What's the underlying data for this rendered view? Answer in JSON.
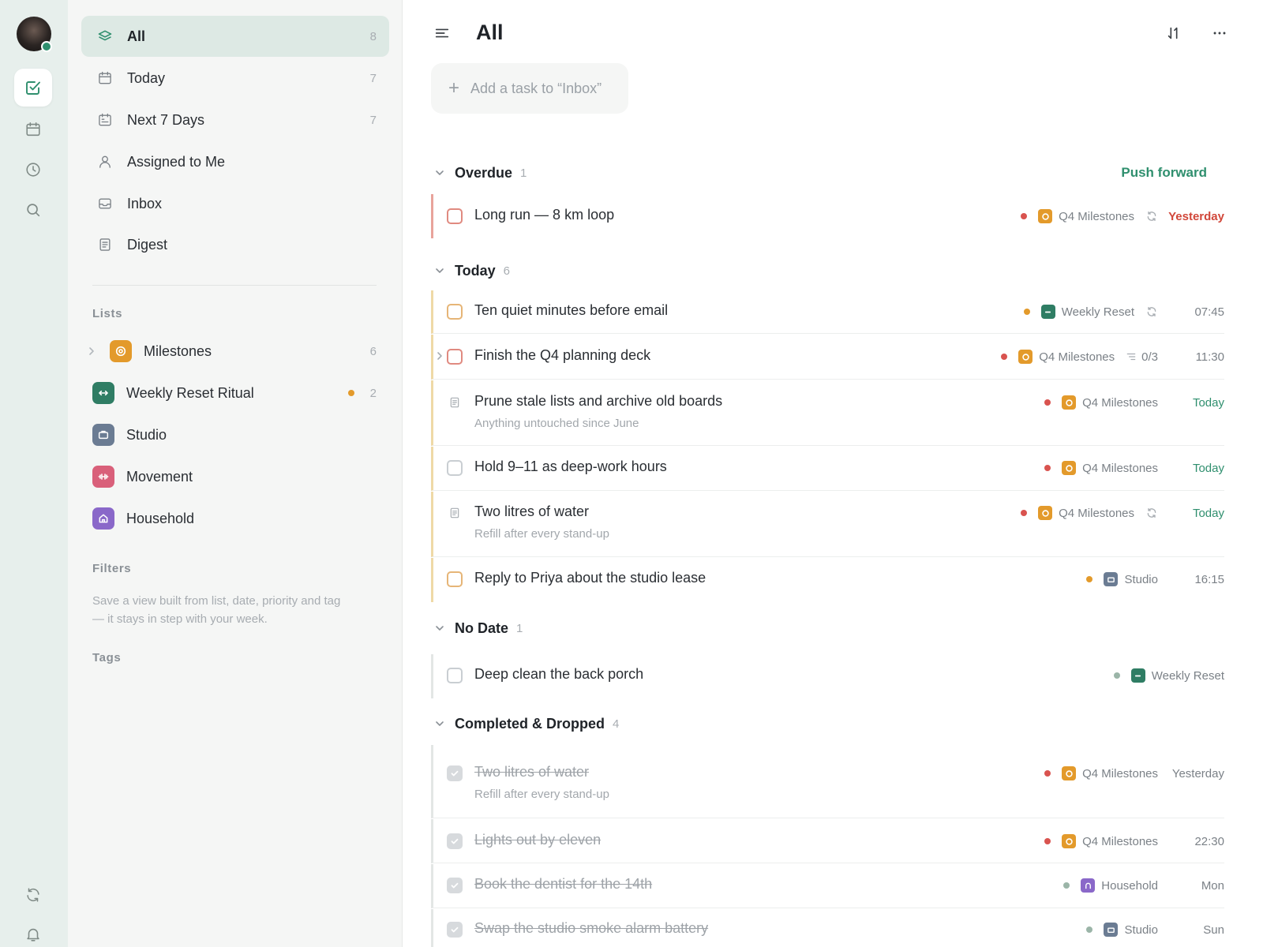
{
  "colors": {
    "accent": "#2f8f6e",
    "overdue": "#d1473a",
    "priority_high": "#d9534f",
    "priority_medium": "#e39a2b",
    "priority_low": "#9bb5a8",
    "list_milestones": "#e39a2b",
    "list_weekly_reset": "#2f7d64",
    "list_studio": "#6b7c93",
    "list_movement": "#d9607a",
    "list_household": "#8a68c9"
  },
  "rail": {
    "items": [
      {
        "icon": "checkbox-icon",
        "active": true
      },
      {
        "icon": "calendar-icon",
        "active": false
      },
      {
        "icon": "clock-icon",
        "active": false
      },
      {
        "icon": "search-icon",
        "active": false
      }
    ],
    "bottom": [
      {
        "icon": "sync-icon"
      },
      {
        "icon": "bell-icon"
      }
    ]
  },
  "sidebar": {
    "nav": [
      {
        "label": "All",
        "count": "8",
        "icon": "layers-icon"
      },
      {
        "label": "Today",
        "count": "7",
        "icon": "calendar-icon"
      },
      {
        "label": "Next 7 Days",
        "count": "7",
        "icon": "calendar-week-icon"
      },
      {
        "label": "Assigned to Me",
        "count": "",
        "icon": "person-icon"
      },
      {
        "label": "Inbox",
        "count": "",
        "icon": "inbox-icon"
      },
      {
        "label": "Digest",
        "count": "",
        "icon": "document-icon"
      }
    ],
    "lists_heading": "Lists",
    "lists": [
      {
        "label": "Milestones",
        "count": "6",
        "icon": "target-icon"
      },
      {
        "label": "Weekly Reset Ritual",
        "count": "2",
        "icon": "arrows-icon"
      },
      {
        "label": "Studio",
        "count": "",
        "icon": "briefcase-icon"
      },
      {
        "label": "Movement",
        "count": "",
        "icon": "dumbbell-icon"
      },
      {
        "label": "Household",
        "count": "",
        "icon": "house-icon"
      }
    ],
    "filters_heading": "Filters",
    "filters_hint": "Save a view built from list, date, priority and tag — it stays in step with your week.",
    "tags_heading": "Tags"
  },
  "header": {
    "title": "All",
    "add_task_placeholder": "Add a task to “Inbox”"
  },
  "groups": {
    "overdue": {
      "title": "Overdue",
      "count": "1",
      "action": "Push forward"
    },
    "today": {
      "title": "Today",
      "count": "6"
    },
    "nodate": {
      "title": "No Date",
      "count": "1"
    },
    "completed": {
      "title": "Completed & Dropped",
      "count": "4"
    }
  },
  "tasks": {
    "overdue": [
      {
        "title": "Long run — 8 km loop",
        "list": "Q4 Milestones",
        "when": "Yesterday",
        "repeat": true,
        "priority": "high"
      }
    ],
    "today": [
      {
        "title": "Ten quiet minutes before email",
        "list": "Weekly Reset",
        "when": "07:45",
        "repeat": true,
        "priority": "medium"
      },
      {
        "title": "Finish the Q4 planning deck",
        "list": "Q4 Milestones",
        "subtasks": "0/3",
        "when": "11:30",
        "priority": "high"
      },
      {
        "title": "Prune stale lists and archive old boards",
        "note": "Anything untouched since June",
        "list": "Q4 Milestones",
        "when": "Today",
        "priority": "high"
      },
      {
        "title": "Hold 9–11 as deep-work hours",
        "list": "Q4 Milestones",
        "when": "Today",
        "priority": "high"
      },
      {
        "title": "Two litres of water",
        "note": "Refill after every stand-up",
        "list": "Q4 Milestones",
        "when": "Today",
        "repeat": true,
        "priority": "high"
      },
      {
        "title": "Reply to Priya about the studio lease",
        "list": "Studio",
        "when": "16:15",
        "priority": "medium"
      }
    ],
    "nodate": [
      {
        "title": "Deep clean the back porch",
        "list": "Weekly Reset",
        "when": "",
        "priority": "low"
      }
    ],
    "completed": [
      {
        "title": "Two litres of water",
        "note": "Refill after every stand-up",
        "list": "Q4 Milestones",
        "when": "Yesterday",
        "priority": "high"
      },
      {
        "title": "Lights out by eleven",
        "list": "Q4 Milestones",
        "when": "22:30",
        "priority": "high"
      },
      {
        "title": "Book the dentist for the 14th",
        "list": "Household",
        "when": "Mon",
        "priority": "low"
      },
      {
        "title": "Swap the studio smoke alarm battery",
        "list": "Studio",
        "when": "Sun",
        "priority": "low"
      }
    ]
  }
}
